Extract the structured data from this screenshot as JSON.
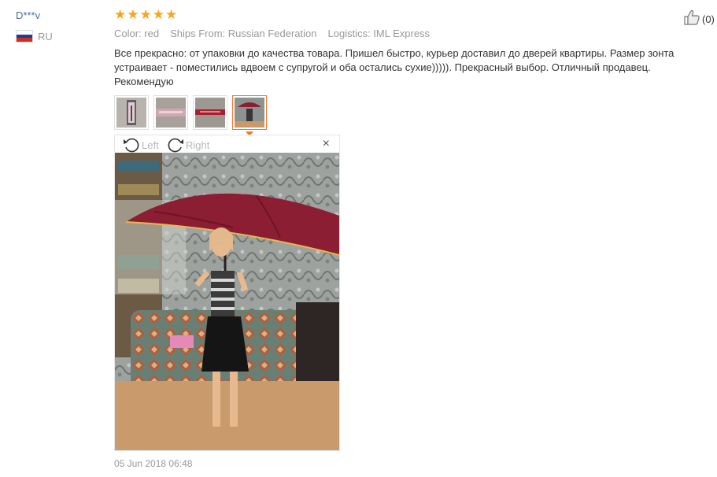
{
  "review": {
    "user": "D***v",
    "country_code": "RU",
    "flag_colors": [
      "#ffffff",
      "#1c3f94",
      "#d52b1e"
    ],
    "rating": 5,
    "star_glyph": "★",
    "meta": {
      "color": "Color: red",
      "ships_from": "Ships From: Russian Federation",
      "logistics": "Logistics: IML Express"
    },
    "helpful_count": "(0)",
    "text": "Все прекрасно: от упаковки до качества товара. Пришел быстро, курьер доставил до дверей квартиры. Размер зонта устраивает - поместились вдвоем с супругой и оба остались сухие))))). Прекрасный выбор. Отличный продавец. Рекомендую",
    "thumbnails": [
      "photo-1",
      "photo-2",
      "photo-3",
      "photo-4"
    ],
    "selected_thumbnail": 4,
    "viewer": {
      "rotate_left_label": "Left",
      "rotate_right_label": "Right",
      "close_glyph": "×"
    },
    "date": "05 Jun 2018 06:48"
  },
  "colors": {
    "accent": "#f07a2a",
    "star": "#f7a51e",
    "link": "#4a6fa5",
    "muted": "#999999"
  },
  "icons": {
    "helpful": "thumbs-up-icon",
    "rotate_left": "rotate-left-icon",
    "rotate_right": "rotate-right-icon",
    "close": "close-icon"
  }
}
